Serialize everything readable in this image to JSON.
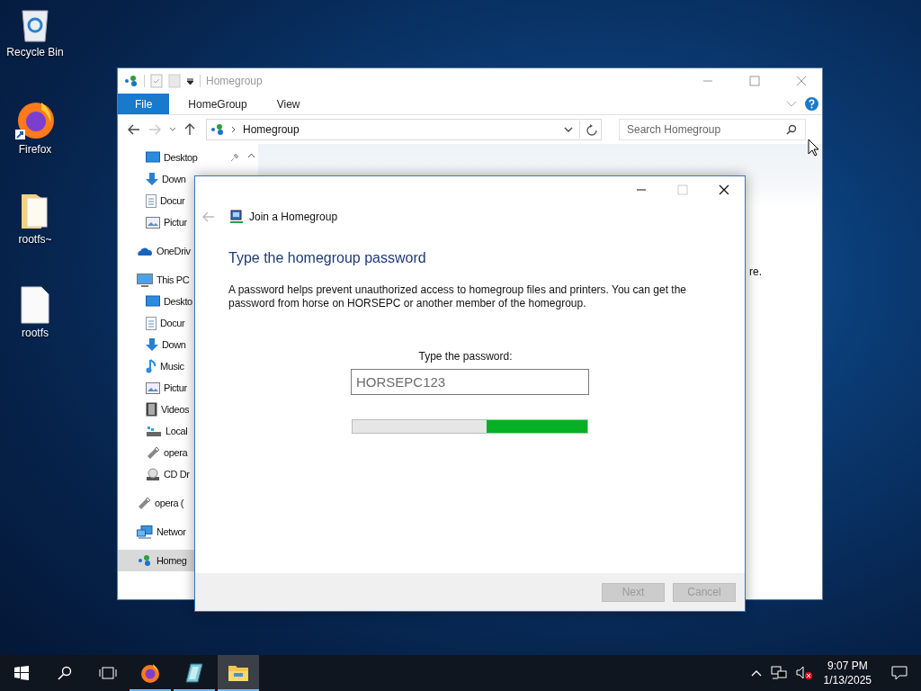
{
  "desktop_icons": [
    {
      "label": "Recycle Bin",
      "kind": "recycle"
    },
    {
      "label": "Firefox",
      "kind": "firefox"
    },
    {
      "label": "rootfs~",
      "kind": "folder"
    },
    {
      "label": "rootfs",
      "kind": "file"
    }
  ],
  "explorer": {
    "title": "Homegroup",
    "ribbon_tabs": [
      {
        "label": "File",
        "kind": "file"
      },
      {
        "label": "HomeGroup",
        "kind": "tab"
      },
      {
        "label": "View",
        "kind": "tab"
      }
    ],
    "address": {
      "location": "Homegroup"
    },
    "search": {
      "placeholder": "Search Homegroup"
    },
    "sidebar": {
      "quick_access": [
        {
          "label": "Desktop",
          "kind": "desktop",
          "pinned": true,
          "selected": false
        },
        {
          "label": "Down",
          "kind": "download",
          "selected": false
        },
        {
          "label": "Docur",
          "kind": "document",
          "selected": false
        },
        {
          "label": "Pictur",
          "kind": "pictures",
          "selected": false
        }
      ],
      "items": [
        {
          "label": "OneDriv",
          "kind": "onedrive",
          "selected": false
        },
        {
          "label": "This PC",
          "kind": "pc",
          "selected": false,
          "children": [
            {
              "label": "Deskto",
              "kind": "desktop",
              "selected": false
            },
            {
              "label": "Docur",
              "kind": "document",
              "selected": false
            },
            {
              "label": "Down",
              "kind": "download",
              "selected": false
            },
            {
              "label": "Music",
              "kind": "music",
              "selected": false
            },
            {
              "label": "Pictur",
              "kind": "pictures",
              "selected": false
            },
            {
              "label": "Videos",
              "kind": "videos",
              "selected": false
            },
            {
              "label": "Local",
              "kind": "drive",
              "selected": false
            },
            {
              "label": "opera",
              "kind": "usb",
              "selected": false
            },
            {
              "label": "CD Dr",
              "kind": "cd",
              "selected": false
            }
          ]
        },
        {
          "label": "opera (",
          "kind": "usb",
          "selected": false
        },
        {
          "label": "Networ",
          "kind": "network",
          "selected": false
        },
        {
          "label": "Homeg",
          "kind": "homegroup",
          "selected": true
        }
      ]
    },
    "content_fragment": "re."
  },
  "dialog": {
    "title": "Join a Homegroup",
    "heading": "Type the homegroup password",
    "description": "A password helps prevent unauthorized access to homegroup files and printers. You can get the password from horse on HORSEPC or another member of the homegroup.",
    "password_label": "Type the password:",
    "password": {
      "value": "HORSEPC123"
    },
    "progress": {
      "level": 0.43
    },
    "buttons": [
      {
        "label": "Next",
        "disabled": true
      },
      {
        "label": "Cancel",
        "disabled": true
      }
    ]
  },
  "taskbar": {
    "apps": [
      {
        "kind": "firefox",
        "running": true,
        "selected": false
      },
      {
        "kind": "glass",
        "running": true,
        "selected": false
      },
      {
        "kind": "explorer",
        "running": true,
        "selected": true
      }
    ],
    "clock": {
      "time": "9:07 PM",
      "date": "1/13/2025"
    }
  }
}
